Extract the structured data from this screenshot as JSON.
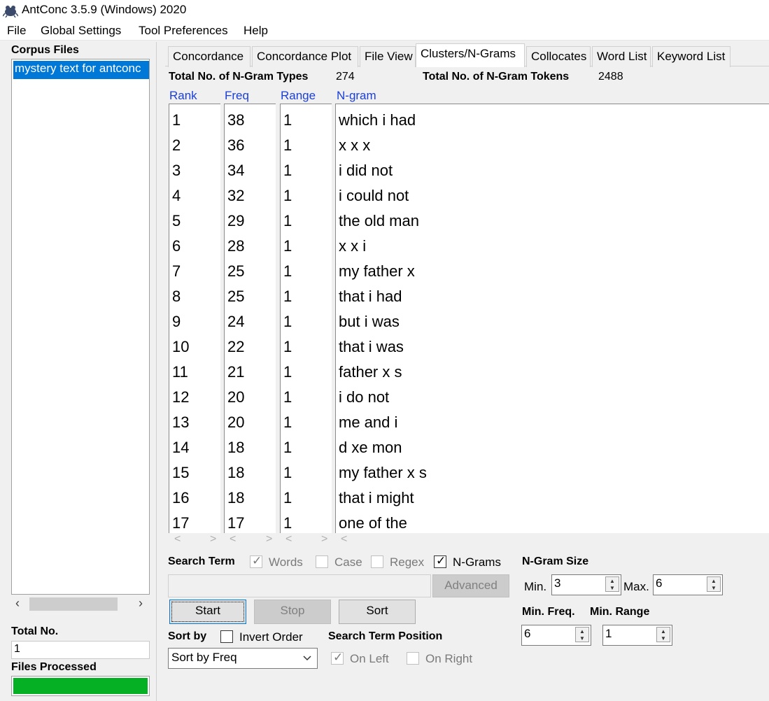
{
  "window": {
    "title": "AntConc 3.5.9 (Windows) 2020"
  },
  "menu": [
    "File",
    "Global Settings",
    "Tool Preferences",
    "Help"
  ],
  "sidebar": {
    "corpus_files_label": "Corpus Files",
    "files": [
      "mystery text for antconc"
    ],
    "total_no_label": "Total No.",
    "total_no_value": "1",
    "files_processed_label": "Files Processed",
    "progress": 1.0
  },
  "tabs": [
    "Concordance",
    "Concordance Plot",
    "File View",
    "Clusters/N-Grams",
    "Collocates",
    "Word List",
    "Keyword List"
  ],
  "active_tab": "Clusters/N-Grams",
  "stats": {
    "types_label": "Total No. of N-Gram Types",
    "types_value": "274",
    "tokens_label": "Total No. of N-Gram Tokens",
    "tokens_value": "2488"
  },
  "columns": [
    "Rank",
    "Freq",
    "Range",
    "N-gram"
  ],
  "rows": [
    [
      "1",
      "38",
      "1",
      "which i had"
    ],
    [
      "2",
      "36",
      "1",
      "x x x"
    ],
    [
      "3",
      "34",
      "1",
      "i did not"
    ],
    [
      "4",
      "32",
      "1",
      "i could not"
    ],
    [
      "5",
      "29",
      "1",
      "the old man"
    ],
    [
      "6",
      "28",
      "1",
      "x x i"
    ],
    [
      "7",
      "25",
      "1",
      "my father x"
    ],
    [
      "8",
      "25",
      "1",
      "that i had"
    ],
    [
      "9",
      "24",
      "1",
      "but i was"
    ],
    [
      "10",
      "22",
      "1",
      "that i was"
    ],
    [
      "11",
      "21",
      "1",
      "father x s"
    ],
    [
      "12",
      "20",
      "1",
      "i do not"
    ],
    [
      "13",
      "20",
      "1",
      "me and i"
    ],
    [
      "14",
      "18",
      "1",
      "d xe mon"
    ],
    [
      "15",
      "18",
      "1",
      "my father x s"
    ],
    [
      "16",
      "18",
      "1",
      "that i might"
    ],
    [
      "17",
      "17",
      "1",
      "one of the"
    ]
  ],
  "search": {
    "label": "Search Term",
    "words_label": "Words",
    "case_label": "Case",
    "regex_label": "Regex",
    "ngrams_label": "N-Grams",
    "term_value": "",
    "advanced_label": "Advanced"
  },
  "ngram_size": {
    "label": "N-Gram Size",
    "min_label": "Min.",
    "min_value": "3",
    "max_label": "Max.",
    "max_value": "6"
  },
  "min_freq": {
    "label": "Min. Freq.",
    "value": "6"
  },
  "min_range": {
    "label": "Min. Range",
    "value": "1"
  },
  "buttons": {
    "start": "Start",
    "stop": "Stop",
    "sort": "Sort"
  },
  "sort": {
    "label": "Sort by",
    "invert_label": "Invert Order",
    "selected": "Sort by Freq"
  },
  "position": {
    "label": "Search Term Position",
    "on_left": "On Left",
    "on_right": "On Right"
  }
}
